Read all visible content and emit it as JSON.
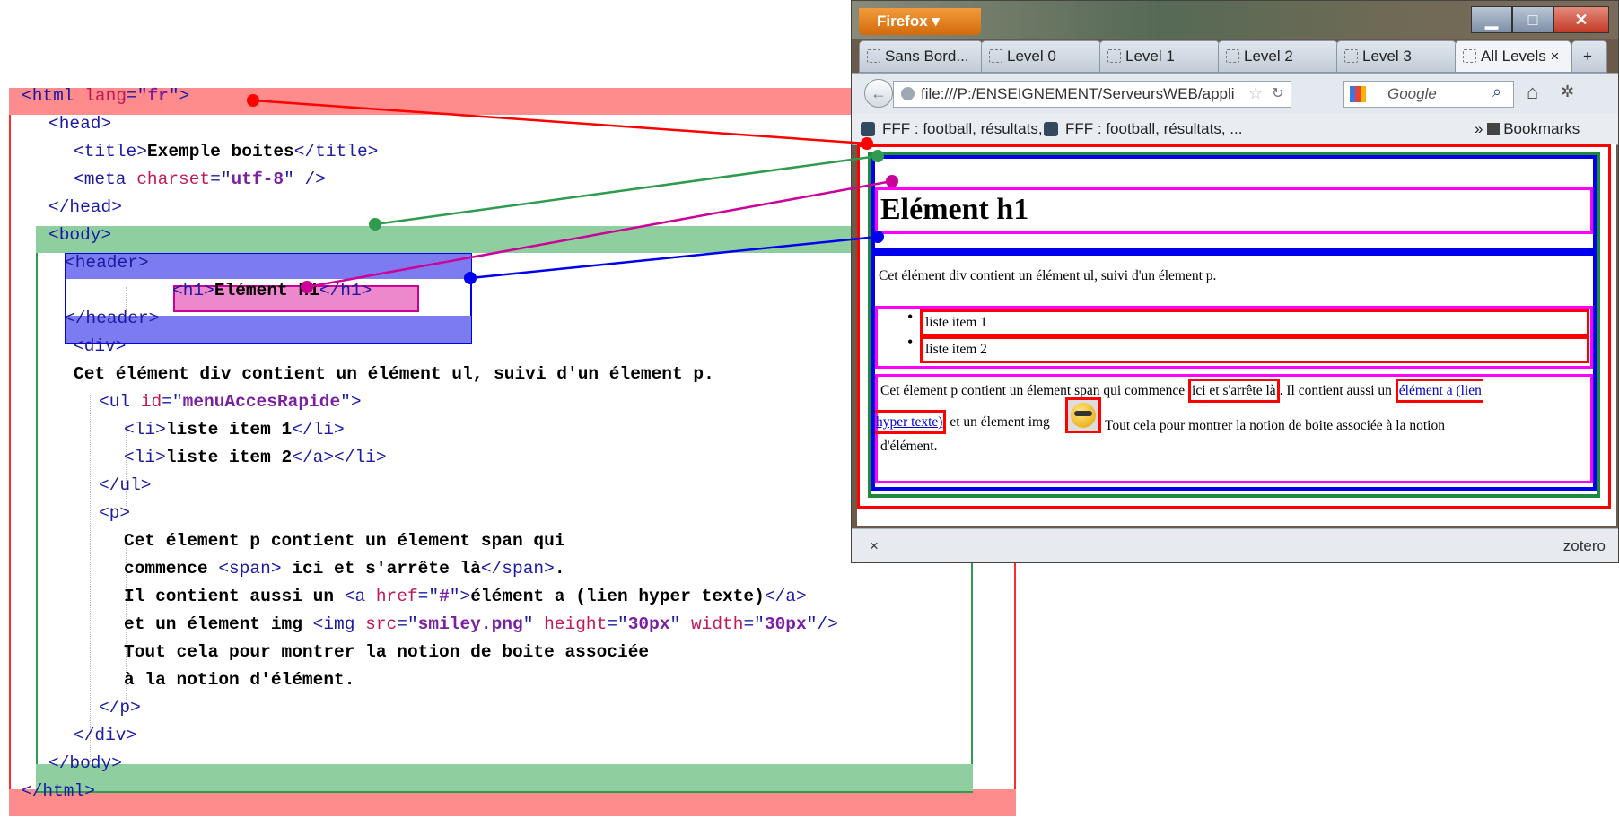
{
  "code": {
    "lines": [
      {
        "parts": [
          {
            "c": "tag",
            "t": "<html "
          },
          {
            "c": "attr",
            "t": "lang"
          },
          {
            "c": "tag",
            "t": "=\""
          },
          {
            "c": "val",
            "t": "fr"
          },
          {
            "c": "tag",
            "t": "\">"
          }
        ]
      },
      {
        "parts": [
          {
            "c": "tag",
            "t": "<head>"
          }
        ]
      },
      {
        "parts": [
          {
            "c": "tag",
            "t": "<title>"
          },
          {
            "c": "txt",
            "t": "Exemple boites"
          },
          {
            "c": "tag",
            "t": "</title>"
          }
        ]
      },
      {
        "parts": [
          {
            "c": "tag",
            "t": "<meta "
          },
          {
            "c": "attr",
            "t": "charset"
          },
          {
            "c": "tag",
            "t": "=\""
          },
          {
            "c": "val",
            "t": "utf-8"
          },
          {
            "c": "tag",
            "t": "\" />"
          }
        ]
      },
      {
        "parts": [
          {
            "c": "tag",
            "t": "</head>"
          }
        ]
      },
      {
        "parts": [
          {
            "c": "tag",
            "t": "<body>"
          }
        ]
      },
      {
        "parts": [
          {
            "c": "tag",
            "t": "<header>"
          }
        ]
      },
      {
        "parts": [
          {
            "c": "tag",
            "t": "<h1>"
          },
          {
            "c": "txt",
            "t": "Elément h1"
          },
          {
            "c": "tag",
            "t": "</h1>"
          }
        ]
      },
      {
        "parts": [
          {
            "c": "tag",
            "t": "</header>"
          }
        ]
      },
      {
        "parts": [
          {
            "c": "tag",
            "t": "<div>"
          }
        ]
      },
      {
        "parts": [
          {
            "c": "txt",
            "t": "Cet élément div contient un élément ul, suivi d'un élement p."
          }
        ]
      },
      {
        "parts": [
          {
            "c": "tag",
            "t": "<ul "
          },
          {
            "c": "attr",
            "t": "id"
          },
          {
            "c": "tag",
            "t": "=\""
          },
          {
            "c": "val",
            "t": "menuAccesRapide"
          },
          {
            "c": "tag",
            "t": "\">"
          }
        ]
      },
      {
        "parts": [
          {
            "c": "tag",
            "t": "<li>"
          },
          {
            "c": "txt",
            "t": "liste item 1"
          },
          {
            "c": "tag",
            "t": "</li>"
          }
        ]
      },
      {
        "parts": [
          {
            "c": "tag",
            "t": "<li>"
          },
          {
            "c": "txt",
            "t": "liste item 2"
          },
          {
            "c": "tag",
            "t": "</a></li>"
          }
        ]
      },
      {
        "parts": [
          {
            "c": "tag",
            "t": "</ul>"
          }
        ]
      },
      {
        "parts": [
          {
            "c": "tag",
            "t": "<p>"
          }
        ]
      },
      {
        "parts": [
          {
            "c": "txt",
            "t": "Cet élement p contient un élement span qui"
          }
        ]
      },
      {
        "parts": [
          {
            "c": "txt",
            "t": "commence "
          },
          {
            "c": "tag",
            "t": "<span>"
          },
          {
            "c": "txt",
            "t": " ici et s'arrête là"
          },
          {
            "c": "tag",
            "t": "</span>"
          },
          {
            "c": "txt",
            "t": "."
          }
        ]
      },
      {
        "parts": [
          {
            "c": "txt",
            "t": "Il contient aussi un "
          },
          {
            "c": "tag",
            "t": "<a "
          },
          {
            "c": "attr",
            "t": "href"
          },
          {
            "c": "tag",
            "t": "=\""
          },
          {
            "c": "val",
            "t": "#"
          },
          {
            "c": "tag",
            "t": "\">"
          },
          {
            "c": "txt",
            "t": "élément a (lien hyper texte)"
          },
          {
            "c": "tag",
            "t": "</a>"
          }
        ]
      },
      {
        "parts": [
          {
            "c": "txt",
            "t": "et un élement img "
          },
          {
            "c": "tag",
            "t": "<img "
          },
          {
            "c": "attr",
            "t": "src"
          },
          {
            "c": "tag",
            "t": "=\""
          },
          {
            "c": "val",
            "t": "smiley.png"
          },
          {
            "c": "tag",
            "t": "\" "
          },
          {
            "c": "attr",
            "t": "height"
          },
          {
            "c": "tag",
            "t": "=\""
          },
          {
            "c": "val",
            "t": "30px"
          },
          {
            "c": "tag",
            "t": "\" "
          },
          {
            "c": "attr",
            "t": "width"
          },
          {
            "c": "tag",
            "t": "=\""
          },
          {
            "c": "val",
            "t": "30px"
          },
          {
            "c": "tag",
            "t": "\"/>"
          }
        ]
      },
      {
        "parts": [
          {
            "c": "txt",
            "t": "Tout cela pour montrer la notion de boite associée"
          }
        ]
      },
      {
        "parts": [
          {
            "c": "txt",
            "t": "à la notion d'élément."
          }
        ]
      },
      {
        "parts": [
          {
            "c": "tag",
            "t": "</p>"
          }
        ]
      },
      {
        "parts": [
          {
            "c": "tag",
            "t": "</div>"
          }
        ]
      },
      {
        "parts": [
          {
            "c": "tag",
            "t": "</body>"
          }
        ]
      },
      {
        "parts": [
          {
            "c": "tag",
            "t": "</html>"
          }
        ]
      }
    ]
  },
  "browser": {
    "menu_label": "Firefox ▾",
    "tabs": [
      "Sans Bord...",
      "Level 0",
      "Level 1",
      "Level 2",
      "Level 3",
      "All Levels"
    ],
    "tab_close": "×",
    "new_tab": "+",
    "url": "file:///P:/ENSEIGNEMENT/ServeursWEB/appli",
    "search_placeholder": "Google",
    "bookmarks": [
      "FFF : football, résultats, ...",
      "FFF : football, résultats, ..."
    ],
    "bookmarks_more": "» ",
    "bookmarks_menu": "Bookmarks",
    "status_close": "×",
    "status_right": "zotero"
  },
  "page": {
    "h1": "Elément h1",
    "div_text": "Cet élément div contient un élément ul, suivi d'un élement p.",
    "list_items": [
      "liste item 1",
      "liste item 2"
    ],
    "p_before_span": "Cet élement p contient un élement span qui commence ",
    "span_text": "ici et s'arrête là",
    "p_after_span": ". Il contient aussi un ",
    "link_line1": "élément a (lien",
    "link_line2": "hyper texte)",
    "p_after_link": " et un élement img",
    "p_tail": " Tout cela pour montrer la notion de boite associée à la notion",
    "p_last": "d'élément."
  },
  "colors": {
    "html": "#ff0000",
    "body": "#2e9b4f",
    "header": "#0000ff",
    "h1": "#cc0099",
    "inline": "#ff00ff"
  }
}
